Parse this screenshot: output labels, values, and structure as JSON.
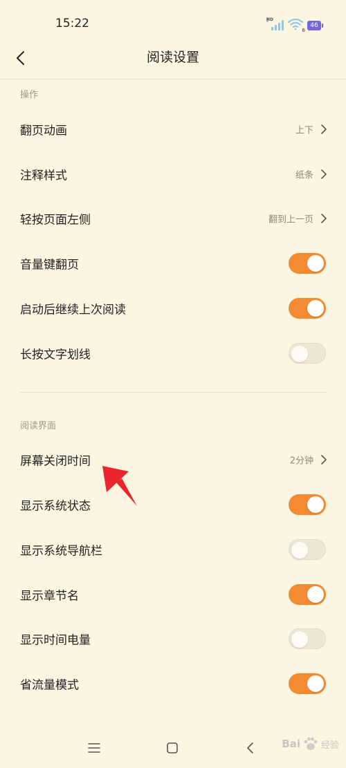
{
  "status_bar": {
    "time": "15:22",
    "hd_label": "HD",
    "wifi_sub": "6",
    "battery": "46"
  },
  "header": {
    "title": "阅读设置"
  },
  "sections": {
    "operation": {
      "label": "操作",
      "items": [
        {
          "label": "翻页动画",
          "value": "上下"
        },
        {
          "label": "注释样式",
          "value": "纸条"
        },
        {
          "label": "轻按页面左侧",
          "value": "翻到上一页"
        },
        {
          "label": "音量键翻页",
          "toggle": "on"
        },
        {
          "label": "启动后继续上次阅读",
          "toggle": "on"
        },
        {
          "label": "长按文字划线",
          "toggle": "off"
        }
      ]
    },
    "reading": {
      "label": "阅读界面",
      "items": [
        {
          "label": "屏幕关闭时间",
          "value": "2分钟"
        },
        {
          "label": "显示系统状态",
          "toggle": "on"
        },
        {
          "label": "显示系统导航栏",
          "toggle": "off"
        },
        {
          "label": "显示章节名",
          "toggle": "on"
        },
        {
          "label": "显示时间电量",
          "toggle": "off"
        },
        {
          "label": "省流量模式",
          "toggle": "on"
        }
      ]
    }
  },
  "watermark": {
    "brand": "Bai",
    "suffix": "经验"
  },
  "colors": {
    "background": "#fbf5e1",
    "toggle_on": "#f38b32",
    "toggle_off": "#ede7d5",
    "annotation": "#e8262b"
  },
  "icons": {
    "back": "chevron-left-icon",
    "chevron": "chevron-right-icon",
    "nav_menu": "menu-icon",
    "nav_home": "home-icon",
    "nav_back": "back-icon"
  }
}
